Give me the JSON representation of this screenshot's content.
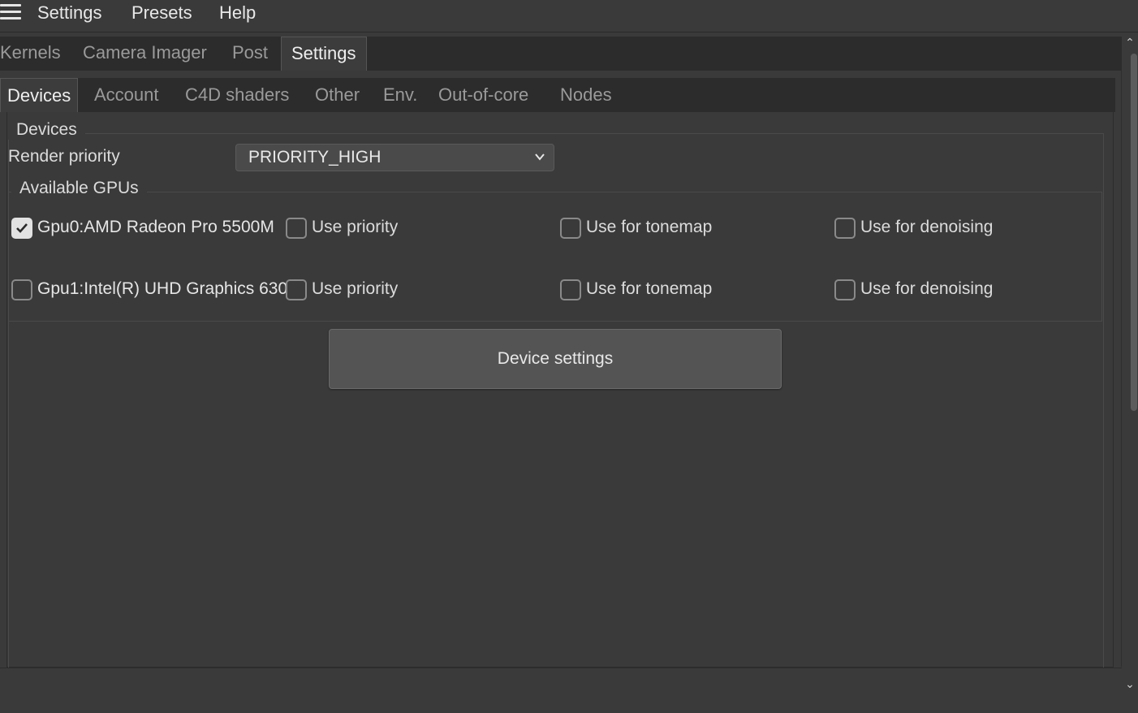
{
  "menubar": {
    "items": [
      "Settings",
      "Presets",
      "Help"
    ]
  },
  "main_tabs": [
    "Kernels",
    "Camera Imager",
    "Post",
    "Settings"
  ],
  "main_tab_active": "Settings",
  "sub_tabs": [
    "Devices",
    "Account",
    "C4D shaders",
    "Other",
    "Env.",
    "Out-of-core",
    "Nodes"
  ],
  "sub_tab_active": "Devices",
  "devices": {
    "group_title": "Devices",
    "render_priority_label": "Render priority",
    "render_priority_value": "PRIORITY_HIGH",
    "gpus_group_title": "Available GPUs",
    "gpus": [
      {
        "name": "Gpu0:AMD Radeon Pro 5500M",
        "enabled": true,
        "use_priority": "Use priority",
        "use_priority_checked": false,
        "use_tonemap": "Use for tonemap",
        "use_tonemap_checked": false,
        "use_denoising": "Use for denoising",
        "use_denoising_checked": false
      },
      {
        "name": "Gpu1:Intel(R) UHD Graphics 630",
        "enabled": false,
        "use_priority": "Use priority",
        "use_priority_checked": false,
        "use_tonemap": "Use for tonemap",
        "use_tonemap_checked": false,
        "use_denoising": "Use for denoising",
        "use_denoising_checked": false
      }
    ],
    "device_settings_button": "Device settings"
  },
  "colors": {
    "background": "#3a3a3a",
    "tab_bar": "#2c2c2c",
    "button": "#545454",
    "text": "#dcdcdc"
  }
}
